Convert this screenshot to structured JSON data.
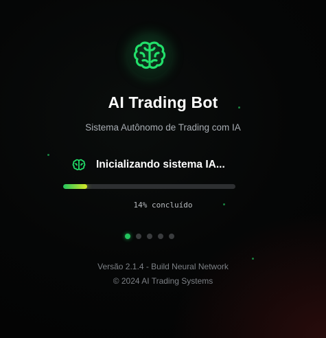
{
  "app": {
    "logo_icon": "brain-icon",
    "title": "AI Trading Bot",
    "subtitle": "Sistema Autônomo de Trading com IA"
  },
  "status": {
    "icon": "brain-icon",
    "text": "Inicializando sistema IA..."
  },
  "progress": {
    "percent": 14,
    "label": "14% concluído"
  },
  "step_indicator": {
    "total": 5,
    "active_index": 0
  },
  "footer": {
    "version": "Versão 2.1.4 - Build Neural Network",
    "copyright": "© 2024 AI Trading Systems"
  },
  "colors": {
    "accent": "#22c55e",
    "accent_end": "#d9e826",
    "background": "#050606",
    "track": "#2d2f31"
  }
}
